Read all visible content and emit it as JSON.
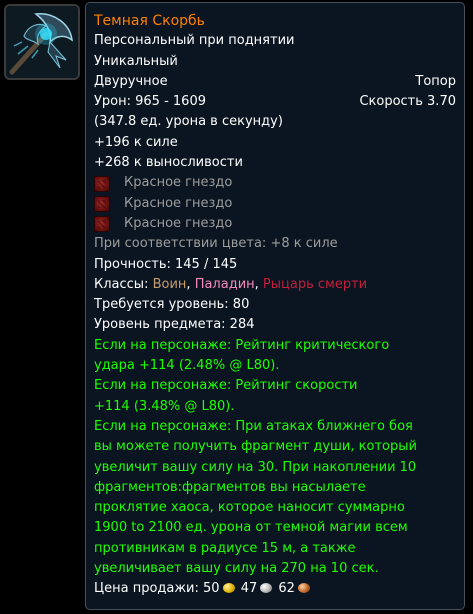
{
  "item": {
    "icon": "two-handed-axe-icon",
    "name": "Темная Скорбь",
    "binding": "Персональный при поднятии",
    "uniqueness": "Уникальный",
    "slot": "Двуручное",
    "type": "Топор",
    "damage": "Урон: 965 - 1609",
    "speed": "Скорость 3.70",
    "dps": "(347.8 ед. урона в секунду)",
    "stats": [
      "+196 к силе",
      "+268 к выносливости"
    ],
    "sockets": [
      "Красное гнездо",
      "Красное гнездо",
      "Красное гнездо"
    ],
    "socket_bonus": "При соответствии цвета: +8 к силе",
    "durability": "Прочность: 145 / 145",
    "classes_label": "Классы:",
    "classes": [
      "Воин",
      "Паладин",
      "Рыцарь смерти"
    ],
    "required_level": "Требуется уровень: 80",
    "item_level": "Уровень предмета: 284",
    "equip_effects": [
      [
        "Если на персонаже: Рейтинг критического",
        "удара +114 (2.48% @ L80)."
      ],
      [
        "Если на персонаже: Рейтинг скорости",
        "+114 (3.48% @ L80)."
      ],
      [
        "Если на персонаже: При атаках ближнего боя",
        "вы можете получить фрагмент души, который",
        "увеличит вашу силу на 30. При накоплении 10",
        "фрагментов:фрагментов вы насылаете",
        "проклятие хаоса, которое наносит суммарно",
        "1900 to 2100 ед. урона от темной магии всем",
        "противникам в радиусе 15 м, а также",
        "увеличивает вашу силу на 270 на 10 сек."
      ]
    ],
    "sell_price_label": "Цена продажи:",
    "sell_gold": "50",
    "sell_silver": "47",
    "sell_copper": "62"
  },
  "colors": {
    "legendary": "#ff8000",
    "equip": "#1eff00",
    "socket": "#9d9d9d",
    "warrior": "#c79c6e",
    "paladin": "#f58cba",
    "death_knight": "#c41f3b",
    "tooltip_bg": "#0b1521"
  }
}
